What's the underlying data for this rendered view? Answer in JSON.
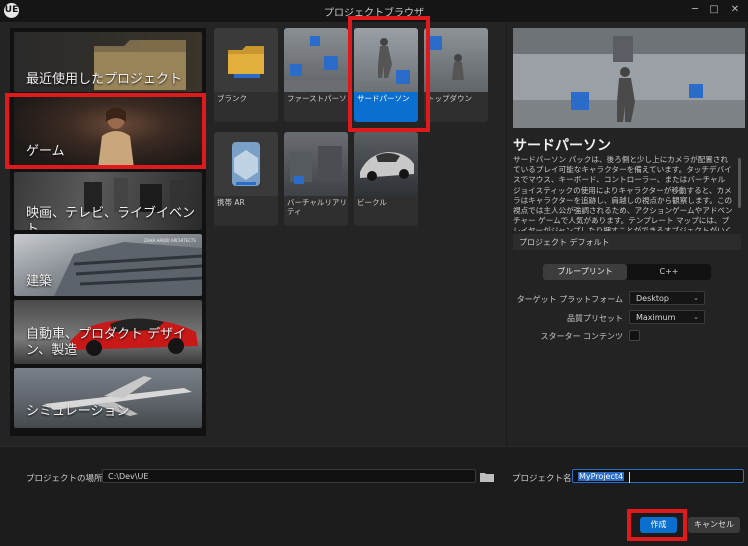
{
  "window": {
    "title": "プロジェクトブラウザ",
    "logo": "UE",
    "minimize": "─",
    "maximize": "□",
    "close": "✕"
  },
  "categories": [
    {
      "label": "最近使用したプロジェクト",
      "icon": "folder-icon"
    },
    {
      "label": "ゲーム",
      "selected": true
    },
    {
      "label": "映画、テレビ、ライブイベント"
    },
    {
      "label": "建築",
      "watermark": "ZAHA HADID ARCHITECTS"
    },
    {
      "label": "自動車、プロダクト デザイン、製造"
    },
    {
      "label": "シミュレーション"
    }
  ],
  "templates": [
    {
      "name": "ブランク",
      "icon": "folder-icon"
    },
    {
      "name": "ファーストパーソン"
    },
    {
      "name": "サードパーソン",
      "selected": true
    },
    {
      "name": "トップダウン"
    },
    {
      "name": "携帯 AR",
      "icon": "ar-device-icon"
    },
    {
      "name": "バーチャルリアリティ"
    },
    {
      "name": "ビークル"
    }
  ],
  "details": {
    "title": "サードパーソン",
    "description": "サードパーソン パックは、後ろ側と少し上にカメラが配置されているプレイ可能なキャラクターを備えています。タッチデバイスでマウス、キーボード、コントローラー、またはバーチャル ジョイスティックの使用によりキャラクターが移動すると、カメラはキャラクターを追跡し、肩越しの視点から観察します。この視点では主人公が強調されるため、アクションゲームやアドベンチャー ゲームで人気があります。テンプレート マップには、プレイヤーがジャンプしたり押すことができるオブジェクトがいくつか含",
    "defaults_header": "プロジェクト デフォルト",
    "toggle": {
      "options": [
        "ブループリント",
        "C++"
      ],
      "selected": "ブループリント"
    },
    "target_platform": {
      "label": "ターゲット プラットフォーム",
      "value": "Desktop"
    },
    "quality_preset": {
      "label": "品質プリセット",
      "value": "Maximum"
    },
    "starter_content": {
      "label": "スターター コンテンツ",
      "checked": false
    }
  },
  "footer": {
    "location_label": "プロジェクトの場所",
    "location_value": "C:\\Dev\\UE",
    "name_label": "プロジェクト名",
    "name_value": "MyProject4",
    "create": "作成",
    "cancel": "キャンセル"
  },
  "colors": {
    "accent": "#0b6fd0",
    "highlight": "#e0191c",
    "panel": "#242424"
  }
}
